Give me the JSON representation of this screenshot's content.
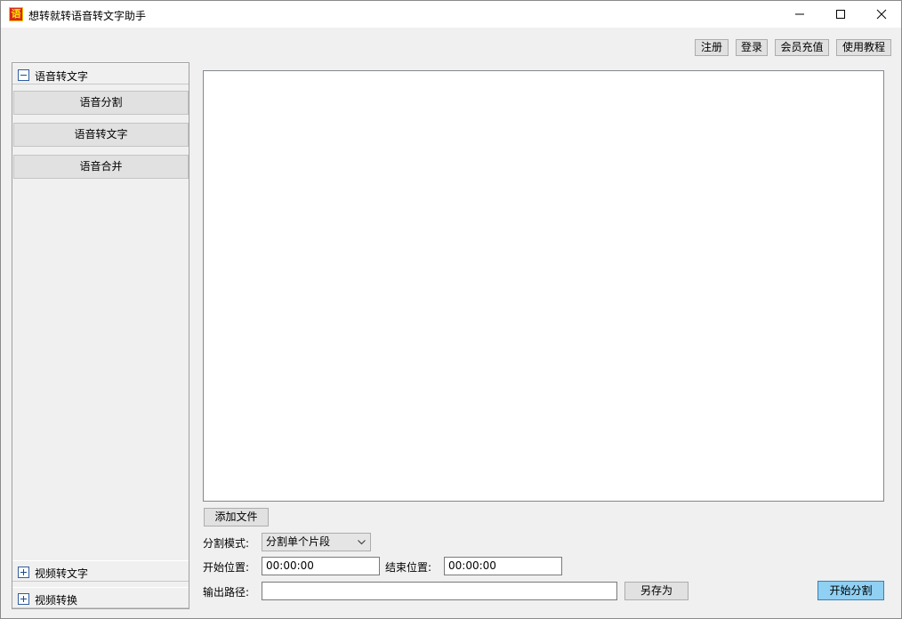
{
  "window": {
    "app_icon_glyph": "语",
    "title": "想转就转语音转文字助手"
  },
  "top_buttons": {
    "register": "注册",
    "login": "登录",
    "member_recharge": "会员充值",
    "tutorial": "使用教程"
  },
  "sidebar": {
    "group1": {
      "label": "语音转文字",
      "expanded": true,
      "items": [
        "语音分割",
        "语音转文字",
        "语音合并"
      ]
    },
    "group2": {
      "label": "视频转文字",
      "expanded": false
    },
    "group3": {
      "label": "视频转换",
      "expanded": false
    }
  },
  "main": {
    "add_file": "添加文件",
    "split_mode_label": "分割模式:",
    "split_mode_value": "分割单个片段",
    "start_pos_label": "开始位置:",
    "start_pos_value": "00:00:00",
    "end_pos_label": "结束位置:",
    "end_pos_value": "00:00:00",
    "output_path_label": "输出路径:",
    "output_path_value": "",
    "save_as": "另存为",
    "start_split": "开始分割"
  },
  "colors": {
    "primary_button": "#8fd0f3",
    "app_icon_bg": "#d7261f",
    "app_icon_fg": "#ffe100"
  },
  "icons": {
    "minimize": "minimize-icon",
    "maximize": "maximize-icon",
    "close": "close-icon",
    "collapse": "minus-box-icon",
    "expand": "plus-box-icon",
    "dropdown": "chevron-down-icon"
  }
}
